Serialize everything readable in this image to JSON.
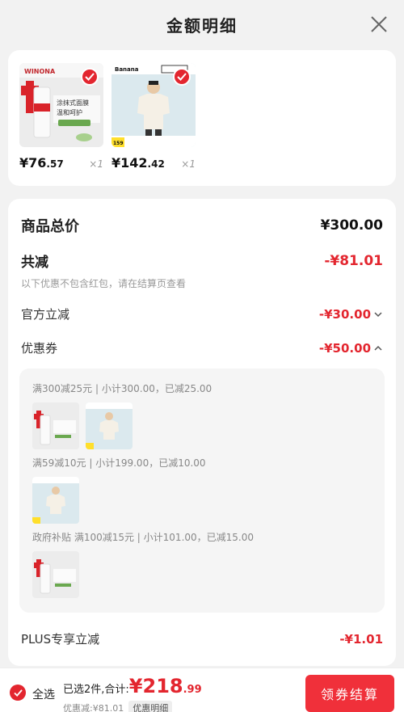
{
  "header": {
    "title": "金额明细"
  },
  "products": [
    {
      "brand": "WINONA",
      "price_int": "¥76",
      "price_dec": ".57",
      "qty": "×1",
      "tag": "涂抹式面膜 温和呵护"
    },
    {
      "brand": "Banana",
      "price_int": "¥142",
      "price_dec": ".42",
      "qty": "×1",
      "tag": "159"
    }
  ],
  "details": {
    "total_label": "商品总价",
    "total_value": "¥300.00",
    "reduce_label": "共减",
    "reduce_value": "-¥81.01",
    "reduce_note": "以下优惠不包含红包，请在结算页查看",
    "official_label": "官方立减",
    "official_value": "-¥30.00",
    "coupon_label": "优惠券",
    "coupon_value": "-¥50.00",
    "coupons": [
      "满300减25元 | 小计300.00，已减25.00",
      "满59减10元 | 小计199.00，已减10.00",
      "政府补贴 满100减15元 | 小计101.00，已减15.00"
    ],
    "plus_label": "PLUS专享立减",
    "plus_value": "-¥1.01"
  },
  "bottom": {
    "select_all": "全选",
    "selected_prefix": "已选2件,合计:",
    "total_int": "¥218",
    "total_dec": ".99",
    "discount": "优惠减:¥81.01",
    "detail_link": "优惠明细",
    "pay_button": "领券结算"
  },
  "colors": {
    "accent": "#e3262f",
    "button": "#f0303a"
  }
}
